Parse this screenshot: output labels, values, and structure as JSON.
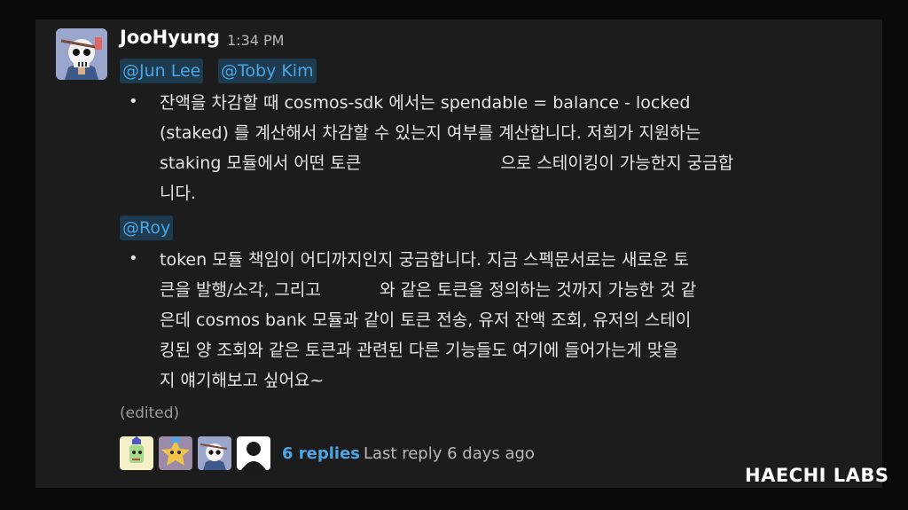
{
  "message": {
    "author": "JooHyung",
    "time": "1:34 PM",
    "mentions_top": [
      "@Jun Lee",
      "@Toby Kim"
    ],
    "bullet_1": {
      "marker": "•",
      "lines": [
        "잔액을 차감할 때 cosmos-sdk 에서는 spendable = balance - locked",
        "(staked) 를 계산해서 차감할 수 있는지 여부를 계산합니다. 저희가 지원하는",
        "staking 모듈에서 어떤 토큰                          으로 스테이킹이 가능한지 궁금합",
        "니다."
      ]
    },
    "mention_mid": "@Roy",
    "bullet_2": {
      "marker": "•",
      "lines": [
        "token 모듈 책임이 어디까지인지 궁금합니다. 지금 스펙문서로는 새로운 토",
        "큰을 발행/소각, 그리고           와 같은 토큰을 정의하는 것까지 가능한 것 같",
        "은데 cosmos bank 모듈과 같이 토큰 전송, 유저 잔액 조회, 유저의 스테이",
        "킹된 양 조회와 같은 토큰과 관련된 다른 기능들도 여기에 들어가는게 맞을",
        "지 얘기해보고 싶어요~"
      ]
    },
    "edited": "(edited)"
  },
  "thread": {
    "reply_count": "6 replies",
    "last_reply": "Last reply 6 days ago",
    "avatars": [
      "avatar-green",
      "avatar-purple",
      "avatar-skull",
      "avatar-placeholder"
    ]
  },
  "brand": "HAECHI LABS",
  "colors": {
    "background": "#1c1c1c",
    "mention_bg": "#1d3a4f",
    "link": "#4aa6e5"
  }
}
